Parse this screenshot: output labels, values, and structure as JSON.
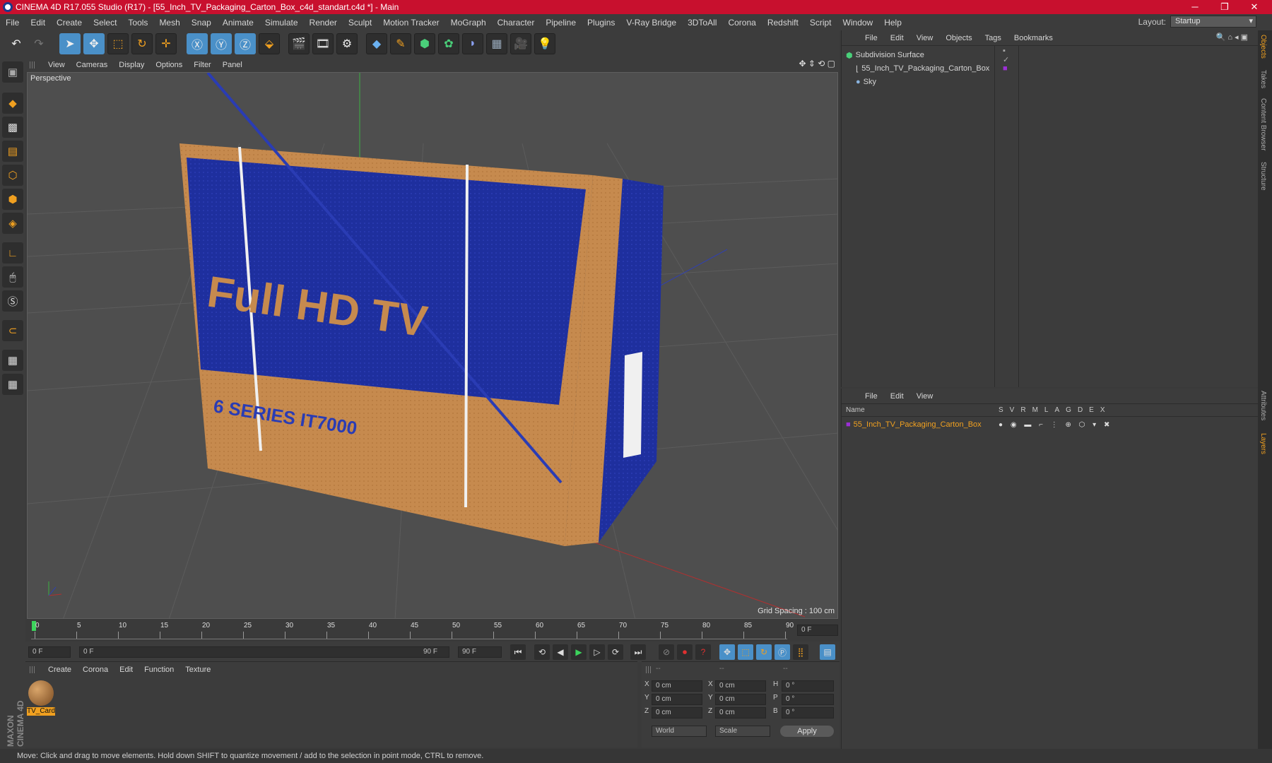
{
  "window": {
    "title": "CINEMA 4D R17.055 Studio (R17) - [55_Inch_TV_Packaging_Carton_Box_c4d_standart.c4d *] - Main"
  },
  "menubar": {
    "items": [
      "File",
      "Edit",
      "Create",
      "Select",
      "Tools",
      "Mesh",
      "Snap",
      "Animate",
      "Simulate",
      "Render",
      "Sculpt",
      "Motion Tracker",
      "MoGraph",
      "Character",
      "Pipeline",
      "Plugins",
      "V-Ray Bridge",
      "3DToAll",
      "Corona",
      "Redshift",
      "Script",
      "Window",
      "Help"
    ],
    "layout_label": "Layout:",
    "layout_value": "Startup"
  },
  "viewport": {
    "menu": [
      "View",
      "Cameras",
      "Display",
      "Options",
      "Filter",
      "Panel"
    ],
    "name": "Perspective",
    "grid_spacing": "Grid Spacing : 100 cm",
    "box_front_text": "Full HD TV",
    "box_series_text": "6 SERIES IT7000"
  },
  "timeline": {
    "ticks": [
      "0",
      "5",
      "10",
      "15",
      "20",
      "25",
      "30",
      "35",
      "40",
      "45",
      "50",
      "55",
      "60",
      "65",
      "70",
      "75",
      "80",
      "85",
      "90"
    ],
    "current_frame": "0 F"
  },
  "playback": {
    "start_frame": "0 F",
    "range_start": "0 F",
    "range_end": "90 F",
    "end_frame": "90 F"
  },
  "material_manager": {
    "menu": [
      "Create",
      "Corona",
      "Edit",
      "Function",
      "Texture"
    ],
    "material_name": "TV_Card"
  },
  "coordinates": {
    "headers": [
      "--",
      "--",
      "--"
    ],
    "rows": [
      {
        "a": "X",
        "av": "0 cm",
        "b": "X",
        "bv": "0 cm",
        "c": "H",
        "cv": "0 °"
      },
      {
        "a": "Y",
        "av": "0 cm",
        "b": "Y",
        "bv": "0 cm",
        "c": "P",
        "cv": "0 °"
      },
      {
        "a": "Z",
        "av": "0 cm",
        "b": "Z",
        "bv": "0 cm",
        "c": "B",
        "cv": "0 °"
      }
    ],
    "mode": "World",
    "scale_mode": "Scale",
    "apply": "Apply"
  },
  "object_manager": {
    "menu": [
      "File",
      "Edit",
      "View",
      "Objects",
      "Tags",
      "Bookmarks"
    ],
    "objects": [
      "Subdivision Surface",
      "55_Inch_TV_Packaging_Carton_Box",
      "Sky"
    ]
  },
  "layer_manager": {
    "menu": [
      "File",
      "Edit",
      "View"
    ],
    "name_header": "Name",
    "flag_headers": [
      "S",
      "V",
      "R",
      "M",
      "L",
      "A",
      "G",
      "D",
      "E",
      "X"
    ],
    "layer_name": "55_Inch_TV_Packaging_Carton_Box"
  },
  "side_tabs": [
    "Objects",
    "Takes",
    "Content Browser",
    "Structure",
    "Attributes",
    "Layers"
  ],
  "brand": "MAXON CINEMA 4D",
  "status": "Move: Click and drag to move elements. Hold down SHIFT to quantize movement / add to the selection in point mode, CTRL to remove.",
  "colors": {
    "title_bar": "#c8102e",
    "accent": "#f0a020",
    "layer_color": "#9c2fd6"
  }
}
